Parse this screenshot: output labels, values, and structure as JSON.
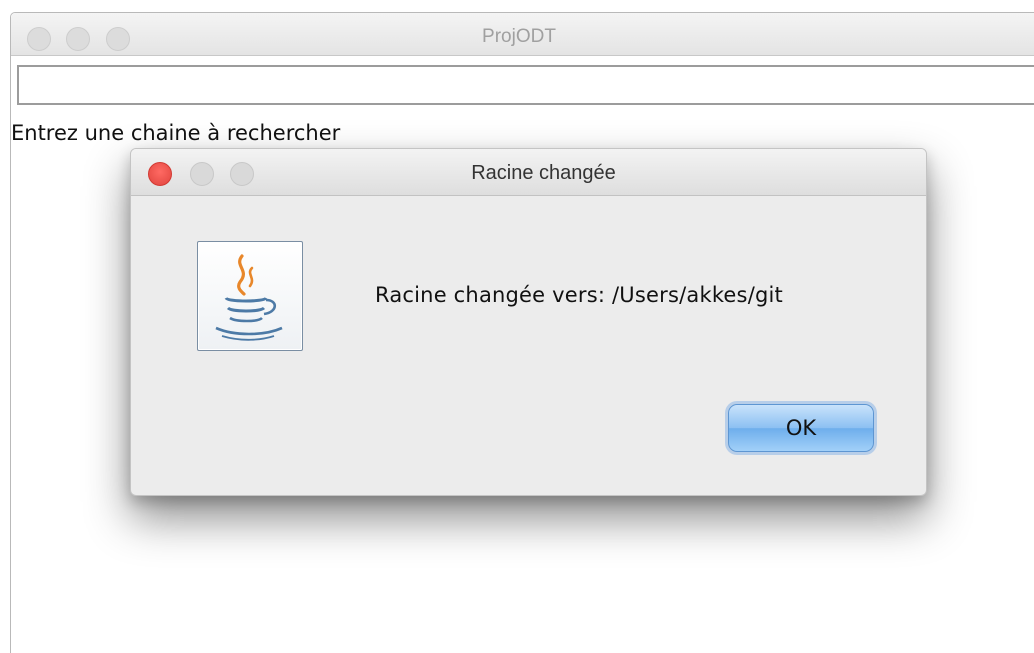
{
  "main_window": {
    "title": "ProjODT",
    "search_value": "",
    "search_label": "Entrez une chaine à rechercher"
  },
  "dialog": {
    "title": "Racine changée",
    "message": "Racine changée vers: /Users/akkes/git",
    "icon": "java-coffee-cup-icon",
    "ok_label": "OK"
  },
  "colors": {
    "close_button": "#ff5f57",
    "ok_button": "#8cc0f2"
  }
}
